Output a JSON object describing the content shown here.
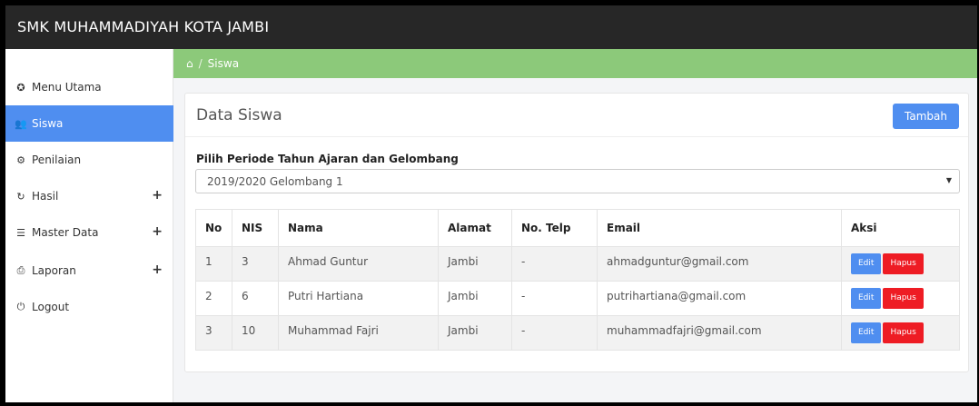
{
  "app": {
    "title": "SMK MUHAMMADIYAH KOTA JAMBI"
  },
  "sidebar": {
    "items": [
      {
        "label": "Menu Utama",
        "icon": "dashboard-icon",
        "glyph": "✪",
        "expandable": false,
        "active": false
      },
      {
        "label": "Siswa",
        "icon": "users-icon",
        "glyph": "👥",
        "expandable": false,
        "active": true
      },
      {
        "label": "Penilaian",
        "icon": "gear-icon",
        "glyph": "⚙",
        "expandable": false,
        "active": false
      },
      {
        "label": "Hasil",
        "icon": "refresh-icon",
        "glyph": "↻",
        "expandable": true,
        "active": false
      },
      {
        "label": "Master Data",
        "icon": "database-icon",
        "glyph": "☰",
        "expandable": true,
        "active": false
      },
      {
        "label": "Laporan",
        "icon": "print-icon",
        "glyph": "⎙",
        "expandable": true,
        "active": false
      },
      {
        "label": "Logout",
        "icon": "power-icon",
        "glyph": "⏻",
        "expandable": false,
        "active": false
      }
    ],
    "expand_glyph": "+"
  },
  "breadcrumb": {
    "home_glyph": "⌂",
    "separator": "/",
    "current": "Siswa"
  },
  "panel": {
    "title": "Data Siswa",
    "add_button": "Tambah",
    "filter_label": "Pilih Periode Tahun Ajaran dan Gelombang",
    "filter_value": "2019/2020 Gelombang 1"
  },
  "table": {
    "headers": [
      "No",
      "NIS",
      "Nama",
      "Alamat",
      "No. Telp",
      "Email",
      "Aksi"
    ],
    "rows": [
      {
        "no": "1",
        "nis": "3",
        "nama": "Ahmad Guntur",
        "alamat": "Jambi",
        "telp": "-",
        "email": "ahmadguntur@gmail.com"
      },
      {
        "no": "2",
        "nis": "6",
        "nama": "Putri Hartiana",
        "alamat": "Jambi",
        "telp": "-",
        "email": "putrihartiana@gmail.com"
      },
      {
        "no": "3",
        "nis": "10",
        "nama": "Muhammad Fajri",
        "alamat": "Jambi",
        "telp": "-",
        "email": "muhammadfajri@gmail.com"
      }
    ],
    "edit_label": "Edit",
    "delete_label": "Hapus"
  },
  "colors": {
    "topbar": "#272727",
    "accent": "#4f8ef0",
    "breadcrumb": "#8cc97a",
    "danger": "#ee1c24"
  }
}
